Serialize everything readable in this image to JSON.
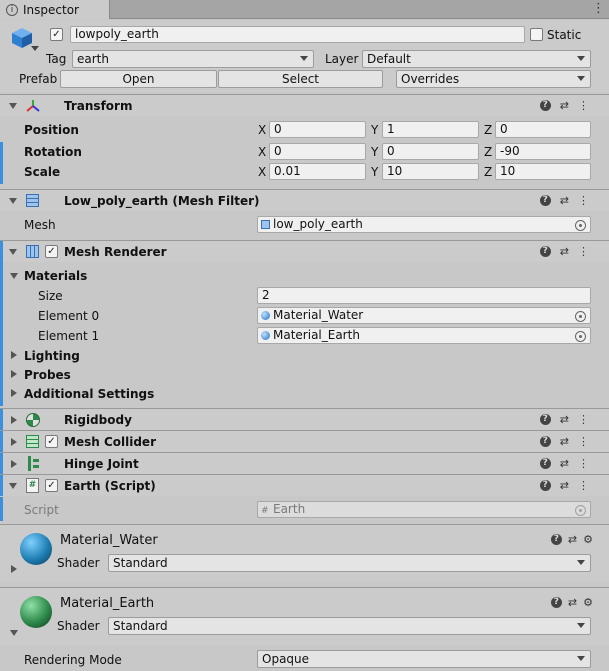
{
  "tab": {
    "title": "Inspector"
  },
  "object": {
    "name": "lowpoly_earth",
    "static_label": "Static",
    "tag_label": "Tag",
    "tag_value": "earth",
    "layer_label": "Layer",
    "layer_value": "Default",
    "prefab_label": "Prefab",
    "open_label": "Open",
    "select_label": "Select",
    "overrides_label": "Overrides"
  },
  "transform": {
    "title": "Transform",
    "rows": [
      {
        "label": "Position",
        "x": "0",
        "y": "1",
        "z": "0"
      },
      {
        "label": "Rotation",
        "x": "0",
        "y": "0",
        "z": "-90"
      },
      {
        "label": "Scale",
        "x": "0.01",
        "y": "10",
        "z": "10"
      }
    ],
    "axis_x": "X",
    "axis_y": "Y",
    "axis_z": "Z"
  },
  "mesh_filter": {
    "title": "Low_poly_earth (Mesh Filter)",
    "mesh_label": "Mesh",
    "mesh_value": "low_poly_earth"
  },
  "mesh_renderer": {
    "title": "Mesh Renderer",
    "materials_label": "Materials",
    "size_label": "Size",
    "size_value": "2",
    "element0_label": "Element 0",
    "element0_value": "Material_Water",
    "element1_label": "Element 1",
    "element1_value": "Material_Earth",
    "lighting_label": "Lighting",
    "probes_label": "Probes",
    "additional_label": "Additional Settings"
  },
  "components": {
    "rigidbody": "Rigidbody",
    "mesh_collider": "Mesh Collider",
    "hinge_joint": "Hinge Joint",
    "earth_script": "Earth (Script)",
    "script_label": "Script",
    "script_value": "Earth"
  },
  "materials": {
    "water_name": "Material_Water",
    "earth_name": "Material_Earth",
    "shader_label": "Shader",
    "shader_value": "Standard",
    "rendering_mode_label": "Rendering Mode",
    "rendering_mode_value": "Opaque"
  },
  "icons": {
    "help": "?",
    "check": "✓",
    "settings": "⇄",
    "menu": "⋮",
    "gear": "⚙"
  },
  "colors": {
    "accent": "#3c8ede",
    "water": "#1f7fb3",
    "earth": "#2e8a4a"
  }
}
